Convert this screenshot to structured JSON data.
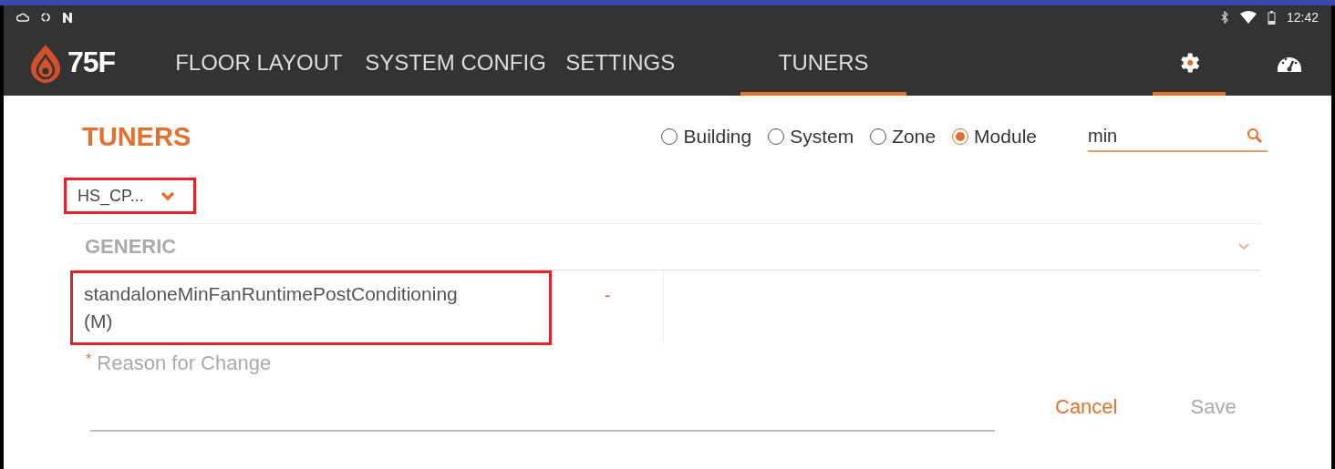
{
  "status_bar": {
    "time": "12:42"
  },
  "nav": {
    "logo": "75F",
    "tabs": [
      {
        "label": "FLOOR LAYOUT",
        "selected": false
      },
      {
        "label": "SYSTEM CONFIG",
        "selected": false
      },
      {
        "label": "SETTINGS",
        "selected": false
      },
      {
        "label": "TUNERS",
        "selected": true
      }
    ],
    "icons": [
      {
        "kind": "settings",
        "selected": true
      },
      {
        "kind": "dashboard",
        "selected": false
      }
    ]
  },
  "title": "TUNERS",
  "scopes": [
    {
      "label": "Building",
      "selected": false
    },
    {
      "label": "System",
      "selected": false
    },
    {
      "label": "Zone",
      "selected": false
    },
    {
      "label": "Module",
      "selected": true
    }
  ],
  "search": {
    "value": "min"
  },
  "module_select": {
    "value": "HS_CP...",
    "highlighted": true
  },
  "section": {
    "label": "GENERIC",
    "expanded": false
  },
  "tuners": [
    {
      "name": "standaloneMinFanRuntimePostConditioning (M)",
      "value": "-",
      "highlighted": true
    }
  ],
  "reason": {
    "required_mark": "*",
    "label": "Reason for Change"
  },
  "buttons": [
    {
      "label": "Cancel",
      "disabled": false
    },
    {
      "label": "Save",
      "disabled": true
    }
  ]
}
